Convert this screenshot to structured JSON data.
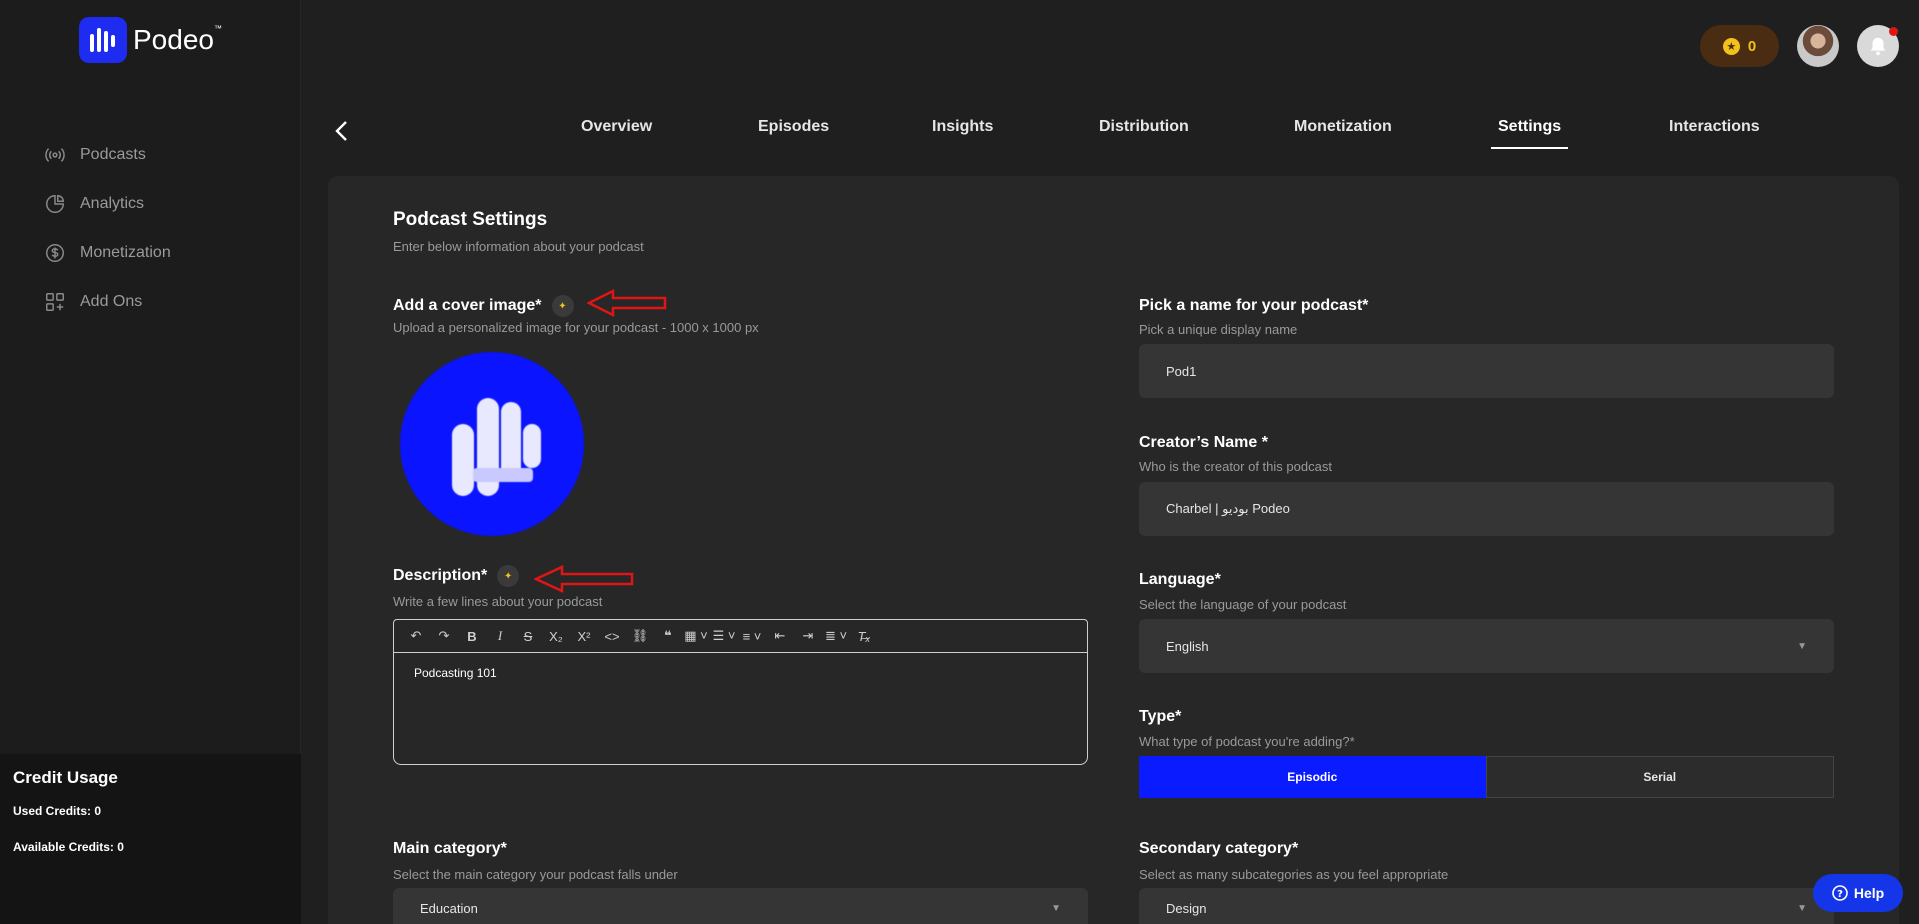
{
  "brand": {
    "name": "Podeo"
  },
  "sidebar": {
    "items": [
      {
        "label": "Podcasts",
        "icon": "broadcast-icon"
      },
      {
        "label": "Analytics",
        "icon": "pie-chart-icon"
      },
      {
        "label": "Monetization",
        "icon": "dollar-circle-icon"
      },
      {
        "label": "Add Ons",
        "icon": "add-grid-icon"
      }
    ],
    "credit": {
      "title": "Credit Usage",
      "used": "Used Credits: 0",
      "available": "Available Credits: 0"
    }
  },
  "header": {
    "coins": "0"
  },
  "tabs": [
    {
      "label": "Overview"
    },
    {
      "label": "Episodes"
    },
    {
      "label": "Insights"
    },
    {
      "label": "Distribution"
    },
    {
      "label": "Monetization"
    },
    {
      "label": "Settings",
      "active": true
    },
    {
      "label": "Interactions"
    }
  ],
  "settings": {
    "title": "Podcast Settings",
    "subtitle": "Enter below information about your podcast",
    "cover": {
      "label": "Add a cover image*",
      "hint": "Upload a personalized image for your podcast - 1000 x 1000 px"
    },
    "description": {
      "label": "Description*",
      "hint": "Write a few lines about your podcast",
      "value": "Podcasting 101"
    },
    "name": {
      "label": "Pick a name for your podcast*",
      "hint": "Pick a unique display name",
      "value": "Pod1"
    },
    "creator": {
      "label": "Creator’s Name *",
      "hint": "Who is the creator of this podcast",
      "value": "Charbel | بوديو Podeo"
    },
    "language": {
      "label": "Language*",
      "hint": "Select the language of your podcast",
      "value": "English"
    },
    "type": {
      "label": "Type*",
      "hint": "What type of podcast you're adding?*",
      "options": [
        "Episodic",
        "Serial"
      ],
      "selected": "Episodic"
    },
    "main_category": {
      "label": "Main category*",
      "hint": "Select the main category your podcast falls under",
      "value": "Education"
    },
    "secondary_category": {
      "label": "Secondary category*",
      "hint": "Select as many subcategories as you feel appropriate",
      "value": "Design"
    }
  },
  "help": {
    "label": "Help"
  },
  "colors": {
    "accent": "#0a1bff",
    "annotation_arrow": "#e01515",
    "coin": "#f3c21a"
  }
}
